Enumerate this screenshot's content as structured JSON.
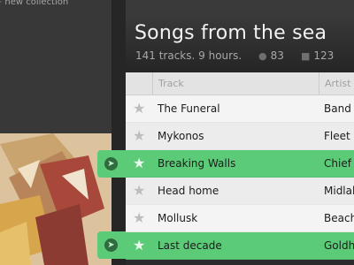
{
  "sidebar": {
    "new_collection_label": "new collection",
    "new_collection_icon": "plus-icon"
  },
  "header": {
    "title": "Songs from the sea",
    "meta": "141 tracks. 9 hours.",
    "followers_icon": "person-icon",
    "followers_count": "83",
    "comments_icon": "speech-bubble-icon",
    "comments_count": "123"
  },
  "columns": {
    "track": "Track",
    "artist": "Artist"
  },
  "tracks": [
    {
      "name": "The Funeral",
      "artist": "Band of",
      "highlighted": false
    },
    {
      "name": "Mykonos",
      "artist": "Fleet Fo",
      "highlighted": false
    },
    {
      "name": "Breaking Walls",
      "artist": "Chief",
      "highlighted": true
    },
    {
      "name": "Head home",
      "artist": "Midlake",
      "highlighted": false
    },
    {
      "name": "Mollusk",
      "artist": "Beach",
      "highlighted": false
    },
    {
      "name": "Last decade",
      "artist": "Goldhe",
      "highlighted": true
    }
  ],
  "colors": {
    "highlight": "#5ccb78",
    "sidebar": "#383838",
    "background": "#2b2b2b"
  }
}
